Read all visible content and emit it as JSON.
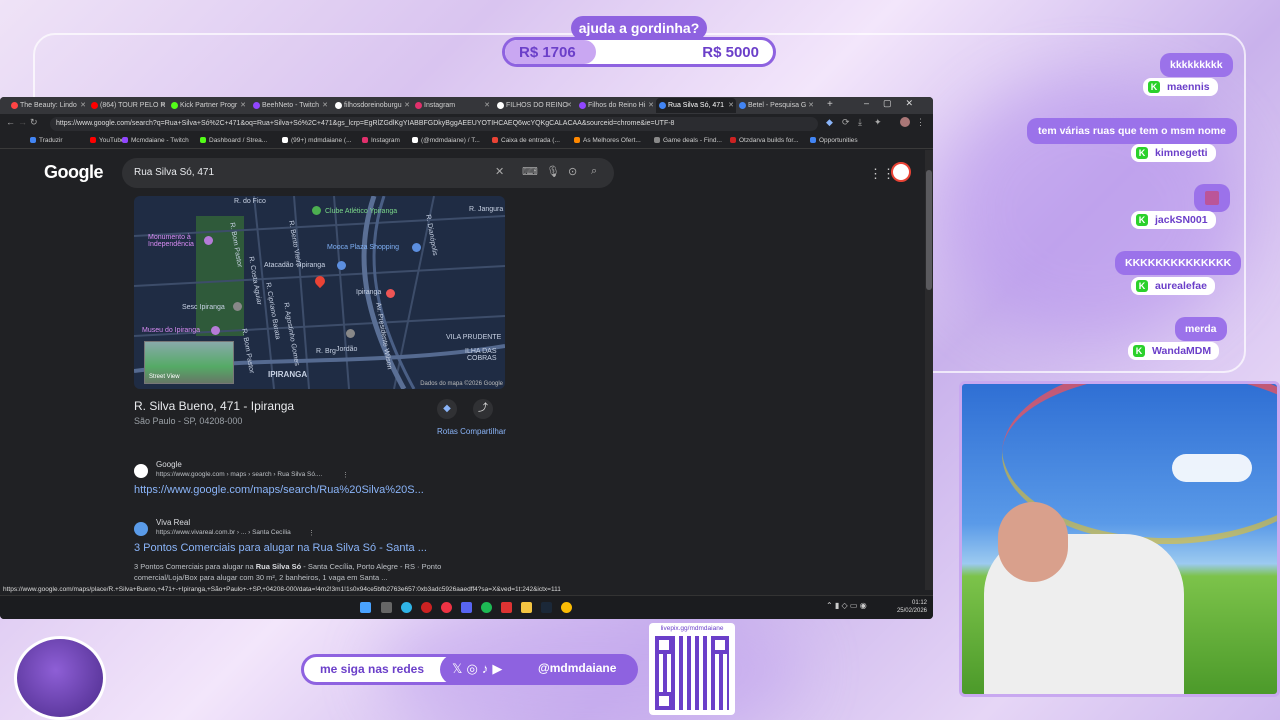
{
  "goal": {
    "title": "ajuda a gordinha?",
    "current": "R$ 1706",
    "target": "R$ 5000",
    "progress": 0.3412
  },
  "browser": {
    "tabs": [
      {
        "label": "The Beauty: Lindo",
        "color": "#ff4444"
      },
      {
        "label": "(864) TOUR PELO R",
        "color": "#ff0000"
      },
      {
        "label": "Kick Partner Progr",
        "color": "#53fc18"
      },
      {
        "label": "BeehNeto - Twitch",
        "color": "#9146ff"
      },
      {
        "label": "filhosdoreinoburgu",
        "color": "#ffffff"
      },
      {
        "label": "Instagram",
        "color": "#e1306c"
      },
      {
        "label": "FILHOS DO REINO",
        "color": "#ffffff"
      },
      {
        "label": "Filhos do Reino Hi",
        "color": "#9146ff"
      },
      {
        "label": "Rua Silva Só, 471",
        "color": "#4285f4"
      },
      {
        "label": "Betel - Pesquisa G",
        "color": "#4285f4"
      }
    ],
    "url": "https://www.google.com/search?q=Rua+Silva+Só%2C+471&oq=Rua+Silva+Só%2C+471&gs_lcrp=EgRlZGdlKgYIABBFGDkyBggAEEUYOTIHCAEQ6wcYQKgCALACAA&sourceid=chrome&ie=UTF-8",
    "bookmarks": [
      {
        "label": "Traduzir",
        "color": "#4285f4"
      },
      {
        "label": "YouTube",
        "color": "#ff0000"
      },
      {
        "label": "Mcmdaiane - Twitch",
        "color": "#9146ff"
      },
      {
        "label": "Dashboard / Strea...",
        "color": "#53fc18"
      },
      {
        "label": "(99+) mdmdaiane (...",
        "color": "#ffffff"
      },
      {
        "label": "Instagram",
        "color": "#e1306c"
      },
      {
        "label": "(@mdmdaiane) / T...",
        "color": "#ffffff"
      },
      {
        "label": "Caixa de entrada (...",
        "color": "#ea4335"
      },
      {
        "label": "As Melhores Ofert...",
        "color": "#ff8800"
      },
      {
        "label": "Game deals - Find...",
        "color": "#888888"
      },
      {
        "label": "Otzdarva builds for...",
        "color": "#cc2222"
      },
      {
        "label": "Opportunities",
        "color": "#4285f4"
      }
    ]
  },
  "google": {
    "logo": "Google",
    "query": "Rua Silva Só, 471",
    "map": {
      "labels": {
        "r_do_fico": "R. do Fico",
        "clube": "Clube Atlético Ypiranga",
        "r_jangura": "R. Jangura",
        "monumento": "Monumento à\nIndependência",
        "mooca": "Mooca Plaza Shopping",
        "atacadao": "Atacadão - Ipiranga",
        "ipiranga_st": "Ipiranga",
        "sesc": "Sesc Ipiranga",
        "museu": "Museu do Ipiranga",
        "vila": "VILA PRUDENTE",
        "ilha": "ILHA DAS\nCOBRAS",
        "ipiranga_big": "IPIRANGA",
        "r_brg": "R. Brg",
        "jordao": "Jordão",
        "r_dianopolis": "R. Dianópolis",
        "r_bom_pastor": "R. Bom Pastor",
        "r_bento_vieira": "R. Bento Vieira",
        "r_costa_aguiar": "R. Costa Aguiar",
        "r_cipriano": "R. Cipriano Barata",
        "r_agostinho": "R. Agostinho Gomes",
        "av_presidente": "Av. Presidente Wilson",
        "r_bom_pastor2": "R. Bom Pastor",
        "street_view": "Street View"
      },
      "credit": "Dados do mapa ©2026 Google"
    },
    "place_title": "R. Silva Bueno, 471 - Ipiranga",
    "place_subtitle": "São Paulo - SP, 04208-000",
    "actions_label": "Rotas Compartilhar",
    "results": [
      {
        "site": "Google",
        "url": "https://www.google.com › maps › search › Rua Silva Só....",
        "title": "https://www.google.com/maps/search/Rua%20Silva%20S...",
        "snippet_pre": "",
        "snippet_bold": "",
        "snippet_post": ""
      },
      {
        "site": "Viva Real",
        "url": "https://www.vivareal.com.br › ... › Santa Cecília",
        "title": "3 Pontos Comerciais para alugar na Rua Silva Só - Santa ...",
        "snippet_pre": "3 Pontos Comerciais para alugar na ",
        "snippet_bold": "Rua Silva Só",
        "snippet_post": " - Santa Cecília, Porto Alegre - RS · Ponto comercial/Loja/Box para alugar com 30 m², 2 banheiros, 1 vaga em Santa ..."
      }
    ],
    "status_url": "https://www.google.com/maps/place/R.+Silva+Bueno,+471+-+Ipiranga,+São+Paulo+-+SP,+04208-000/data=!4m2!3m1!1s0x94ce5bfb2763e657:0xb3adc5926aaedff4?sa=X&ved=1t:242&ictx=111"
  },
  "taskbar": {
    "time": "01:12",
    "date": "25/02/2026"
  },
  "chat": [
    {
      "message": "kkkkkkkkk",
      "user": "maennis"
    },
    {
      "message": "tem várias ruas que tem o msm nome",
      "user": "kimnegetti"
    },
    {
      "message": "",
      "user": "jackSN001"
    },
    {
      "message": "KKKKKKKKKKKKKK",
      "user": "aurealefae"
    },
    {
      "message": "merda",
      "user": "WandaMDM"
    }
  ],
  "footer": {
    "follow_label": "me siga nas redes",
    "handle": "@mdmdaiane",
    "qr_label": "livepix.gg/mdmdaiane"
  }
}
